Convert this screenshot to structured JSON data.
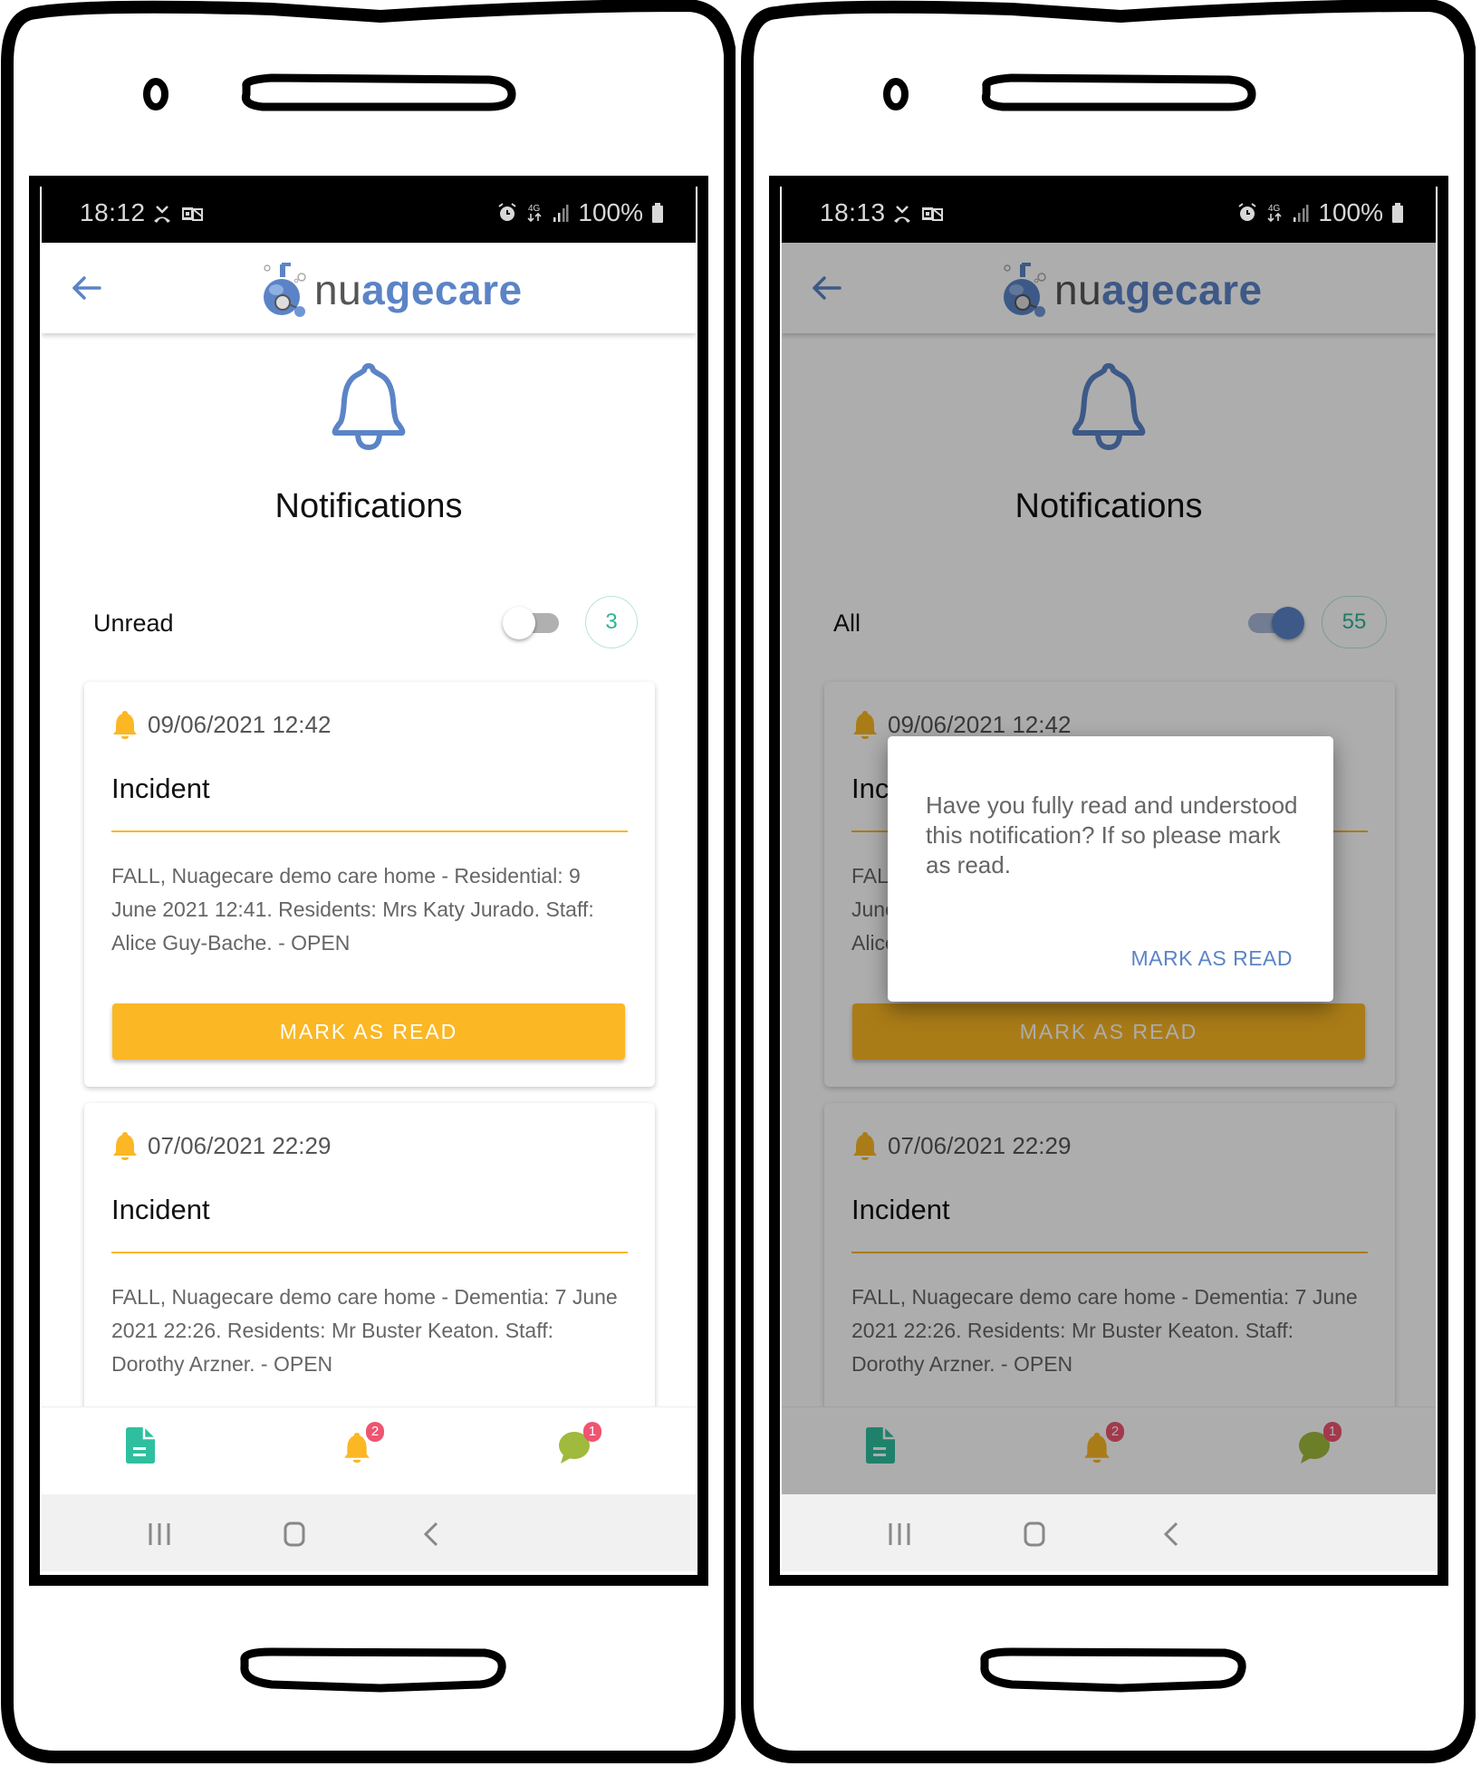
{
  "app": {
    "name_prefix": "nu",
    "name_suffix": "agecare",
    "brand_color": "#5b84c7",
    "accent_color": "#fbb724",
    "badge_color": "#ef5471",
    "count_color": "#2fb596"
  },
  "phones": [
    {
      "status_bar": {
        "time": "18:12",
        "battery": "100%",
        "network": "4G"
      },
      "page_title": "Notifications",
      "filter": {
        "label": "Unread",
        "toggle_on": false,
        "count": "3"
      },
      "cards": [
        {
          "date": "09/06/2021 12:42",
          "title": "Incident",
          "body": "FALL, Nuagecare demo care home - Residential: 9 June 2021 12:41. Residents: Mrs Katy Jurado. Staff: Alice Guy-Bache. - OPEN",
          "button": "MARK AS READ"
        },
        {
          "date": "07/06/2021 22:29",
          "title": "Incident",
          "body": "FALL, Nuagecare demo care home - Dementia: 7 June 2021 22:26. Residents: Mr Buster Keaton. Staff: Dorothy Arzner. - OPEN"
        }
      ],
      "bottom_nav": {
        "docs_icon": "document-icon",
        "alerts_icon": "bell-icon",
        "alerts_badge": "2",
        "chat_icon": "chat-icon",
        "chat_badge": "1"
      }
    },
    {
      "status_bar": {
        "time": "18:13",
        "battery": "100%",
        "network": "4G"
      },
      "page_title": "Notifications",
      "filter": {
        "label": "All",
        "toggle_on": true,
        "count": "55"
      },
      "cards": [
        {
          "date": "09/06/2021 12:42",
          "title": "Incident",
          "body": "FALL, Nuagecare demo care home - Residential: 9 June 2021 12:41. Residents: Mrs Katy Jurado. Staff: Alice Guy-Bache. - OPEN",
          "button": "MARK AS READ"
        },
        {
          "date": "07/06/2021 22:29",
          "title": "Incident",
          "body": "FALL, Nuagecare demo care home - Dementia: 7 June 2021 22:26. Residents: Mr Buster Keaton. Staff: Dorothy Arzner. - OPEN"
        }
      ],
      "bottom_nav": {
        "docs_icon": "document-icon",
        "alerts_icon": "bell-icon",
        "alerts_badge": "2",
        "chat_icon": "chat-icon",
        "chat_badge": "1"
      },
      "dialog": {
        "message": "Have you fully read and understood this notification? If so please mark as read.",
        "action": "MARK AS READ"
      }
    }
  ]
}
